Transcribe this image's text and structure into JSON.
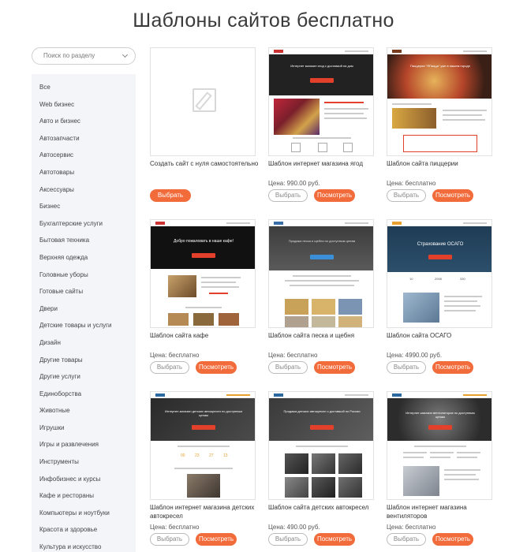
{
  "page": {
    "title": "Шаблоны сайтов бесплатно"
  },
  "search": {
    "placeholder": "Поиск по разделу"
  },
  "sidebar": {
    "items": [
      "Все",
      "Web бизнес",
      "Авто и бизнес",
      "Автозапчасти",
      "Автосервис",
      "Автотовары",
      "Аксессуары",
      "Бизнес",
      "Бухгалтерские услуги",
      "Бытовая техника",
      "Верхняя одежда",
      "Головные уборы",
      "Готовые сайты",
      "Двери",
      "Детские товары и услуги",
      "Дизайн",
      "Другие товары",
      "Другие услуги",
      "Единоборства",
      "Животные",
      "Игрушки",
      "Игры и развлечения",
      "Инструменты",
      "Инфобизнес и курсы",
      "Кафе и рестораны",
      "Компьютеры и ноутбуки",
      "Красота и здоровье",
      "Культура и искусство"
    ]
  },
  "buttons": {
    "select": "Выбрать",
    "view": "Посмотреть"
  },
  "cards": [
    {
      "title": "Создать сайт с нуля самостоятельно",
      "price": ""
    },
    {
      "title": "Шаблон интернет магазина ягод",
      "price": "Цена: 990.00 руб."
    },
    {
      "title": "Шаблон сайта пиццерии",
      "price": "Цена: бесплатно"
    },
    {
      "title": "Шаблон сайта кафе",
      "price": "Цена: бесплатно"
    },
    {
      "title": "Шаблон сайта песка и щебня",
      "price": "Цена: бесплатно"
    },
    {
      "title": "Шаблон сайта ОСАГО",
      "price": "Цена: 4990.00 руб."
    },
    {
      "title": "Шаблон интернет магазина детских автокресел",
      "price": "Цена: бесплатно"
    },
    {
      "title": "Шаблон сайта детских автокресел",
      "price": "Цена: 490.00 руб."
    },
    {
      "title": "Шаблон интернет магазина вентиляторов",
      "price": "Цена: бесплатно"
    }
  ],
  "thumbs": {
    "berries_hero": "Интернет магазин ягод с доставкой на дом",
    "pizza_hero": "Пиццерия \"ЯПицца\" уже в нашем городе",
    "cafe_hero": "Добро пожаловать в наше кафе!",
    "sand_hero": "Продажа песка и щебня по доступным ценам",
    "osago_hero": "Страхование ОСАГО",
    "osago_stats": [
      "10",
      "2008",
      "330"
    ],
    "seats_hero": "Интернет-магазин детских автокресел по доступным ценам",
    "seats_timer": [
      "00",
      "23",
      "27",
      "13"
    ],
    "seats2_hero": "Продажа детских автокресел с доставкой по России",
    "fans_hero": "Интернет-магазин вентиляторов по доступным ценам"
  },
  "colors": {
    "accent": "#f26b3a",
    "sidebar_bg": "#f3f5f9",
    "title": "#3a3a3a"
  }
}
